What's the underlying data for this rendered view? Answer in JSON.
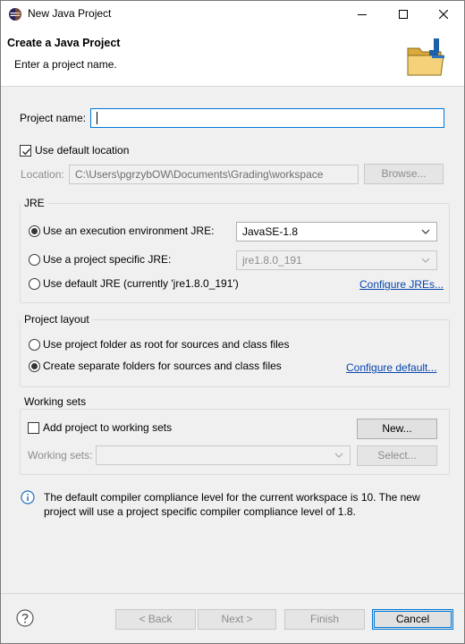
{
  "window": {
    "title": "New Java Project",
    "banner_title": "Create a Java Project",
    "banner_subtitle": "Enter a project name."
  },
  "project": {
    "name_label": "Project name:",
    "name_value": "",
    "use_default_location_label": "Use default location",
    "use_default_location_checked": true,
    "location_label": "Location:",
    "location_value": "C:\\Users\\pgrzybOW\\Documents\\Grading\\workspace",
    "browse_label": "Browse..."
  },
  "jre": {
    "group_title": "JRE",
    "options": [
      {
        "label": "Use an execution environment JRE:",
        "selected": true
      },
      {
        "label": "Use a project specific JRE:",
        "selected": false
      },
      {
        "label": "Use default JRE (currently 'jre1.8.0_191')",
        "selected": false
      }
    ],
    "execution_env_value": "JavaSE-1.8",
    "project_specific_value": "jre1.8.0_191",
    "configure_link": "Configure JREs..."
  },
  "layout": {
    "group_title": "Project layout",
    "options": [
      {
        "label": "Use project folder as root for sources and class files",
        "selected": false
      },
      {
        "label": "Create separate folders for sources and class files",
        "selected": true
      }
    ],
    "configure_link": "Configure default..."
  },
  "working_sets": {
    "group_title": "Working sets",
    "add_label": "Add project to working sets",
    "add_checked": false,
    "new_button": "New...",
    "sets_label": "Working sets:",
    "sets_value": "",
    "select_button": "Select..."
  },
  "info": {
    "message": "The default compiler compliance level for the current workspace is 10. The new project will use a project specific compiler compliance level of 1.8."
  },
  "footer": {
    "back": "< Back",
    "next": "Next >",
    "finish": "Finish",
    "cancel": "Cancel"
  },
  "colors": {
    "accent": "#0078d7",
    "link": "#0645ad",
    "window_bg": "#f0f0f0"
  }
}
